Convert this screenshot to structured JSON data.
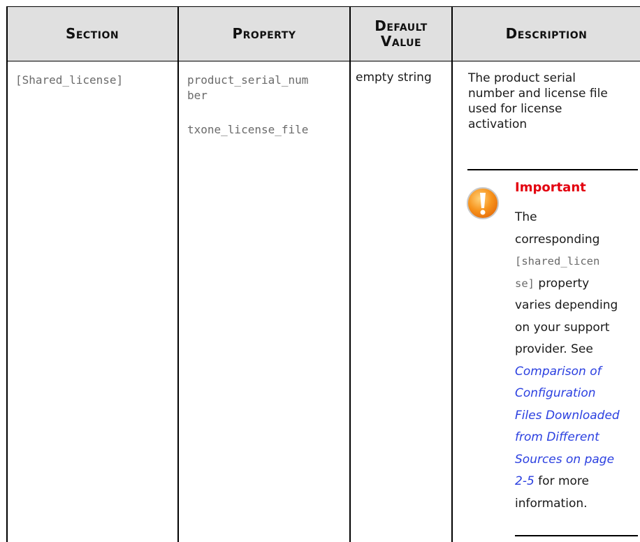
{
  "headers": {
    "section": "Section",
    "property": "Property",
    "default_value_line1": "Default",
    "default_value_line2": "Value",
    "description": "Description"
  },
  "row": {
    "section": "[Shared_license]",
    "property_1_line1": "product_serial_num",
    "property_1_line2": "ber",
    "property_2": "txone_license_file",
    "default_value": "empty string",
    "description_lines": [
      "The product serial",
      "number and license file",
      "used for license",
      "activation"
    ]
  },
  "note": {
    "icon": "warning-icon",
    "heading": "Important",
    "heading_color": "#e3000f",
    "lines": {
      "l1": "The",
      "l2": "corresponding",
      "code1": "[shared_licen",
      "code2": "se]",
      "l4_suffix": " property",
      "l5": "varies depending",
      "l6": "on your support",
      "l7": "provider. See",
      "link_lines": [
        "Comparison of",
        "Configuration",
        "Files Downloaded",
        "from Different",
        "Sources on page",
        "2-5"
      ],
      "after_link": " for more",
      "last": "information."
    },
    "link_color": "#2a3fe0"
  }
}
